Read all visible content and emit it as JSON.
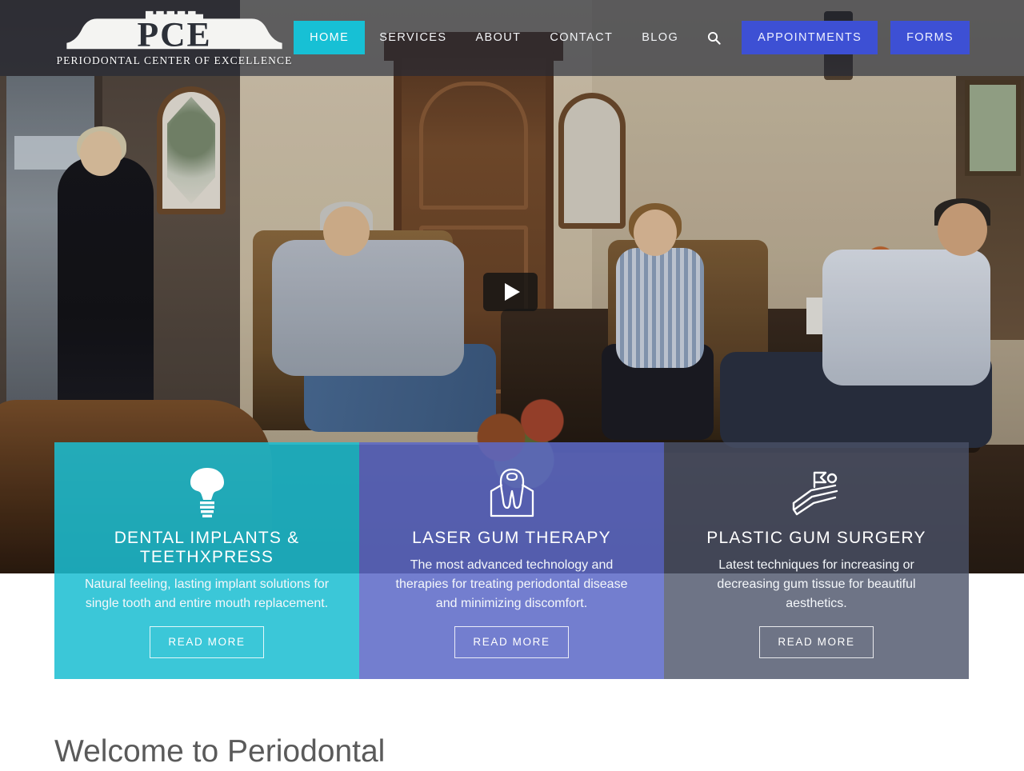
{
  "site": {
    "logo_main": "PCE",
    "logo_sub": "PERIODONTAL CENTER OF EXCELLENCE"
  },
  "nav": {
    "items": [
      {
        "label": "HOME",
        "active": true
      },
      {
        "label": "SERVICES",
        "active": false
      },
      {
        "label": "ABOUT",
        "active": false
      },
      {
        "label": "CONTACT",
        "active": false
      },
      {
        "label": "BLOG",
        "active": false
      }
    ],
    "search_icon": "search-icon",
    "cta": [
      {
        "label": "APPOINTMENTS"
      },
      {
        "label": "FORMS"
      }
    ]
  },
  "hero": {
    "play_icon": "play-triangle-icon",
    "media_type": "video"
  },
  "cards": [
    {
      "icon": "dental-implant-icon",
      "title": "DENTAL IMPLANTS & TEETHXPRESS",
      "desc": "Natural feeling, lasting implant solutions for single tooth and entire mouth replacement.",
      "button": "READ MORE",
      "color": "#1bbed2"
    },
    {
      "icon": "tooth-gums-icon",
      "title": "LASER GUM THERAPY",
      "desc": "The most advanced technology and therapies for treating periodontal disease and minimizing discomfort.",
      "button": "READ MORE",
      "color": "#5c69c7"
    },
    {
      "icon": "gum-surgery-hand-icon",
      "title": "PLASTIC GUM SURGERY",
      "desc": "Latest techniques for increasing or decreasing gum tissue for beautiful aesthetics.",
      "button": "READ MORE",
      "color": "#4a5168"
    }
  ],
  "welcome": {
    "title": "Welcome to Periodontal"
  },
  "theme": {
    "accent_teal": "#17c0d5",
    "accent_blue": "#3d50d4",
    "header_overlay": "rgba(32,38,54,.62)"
  }
}
